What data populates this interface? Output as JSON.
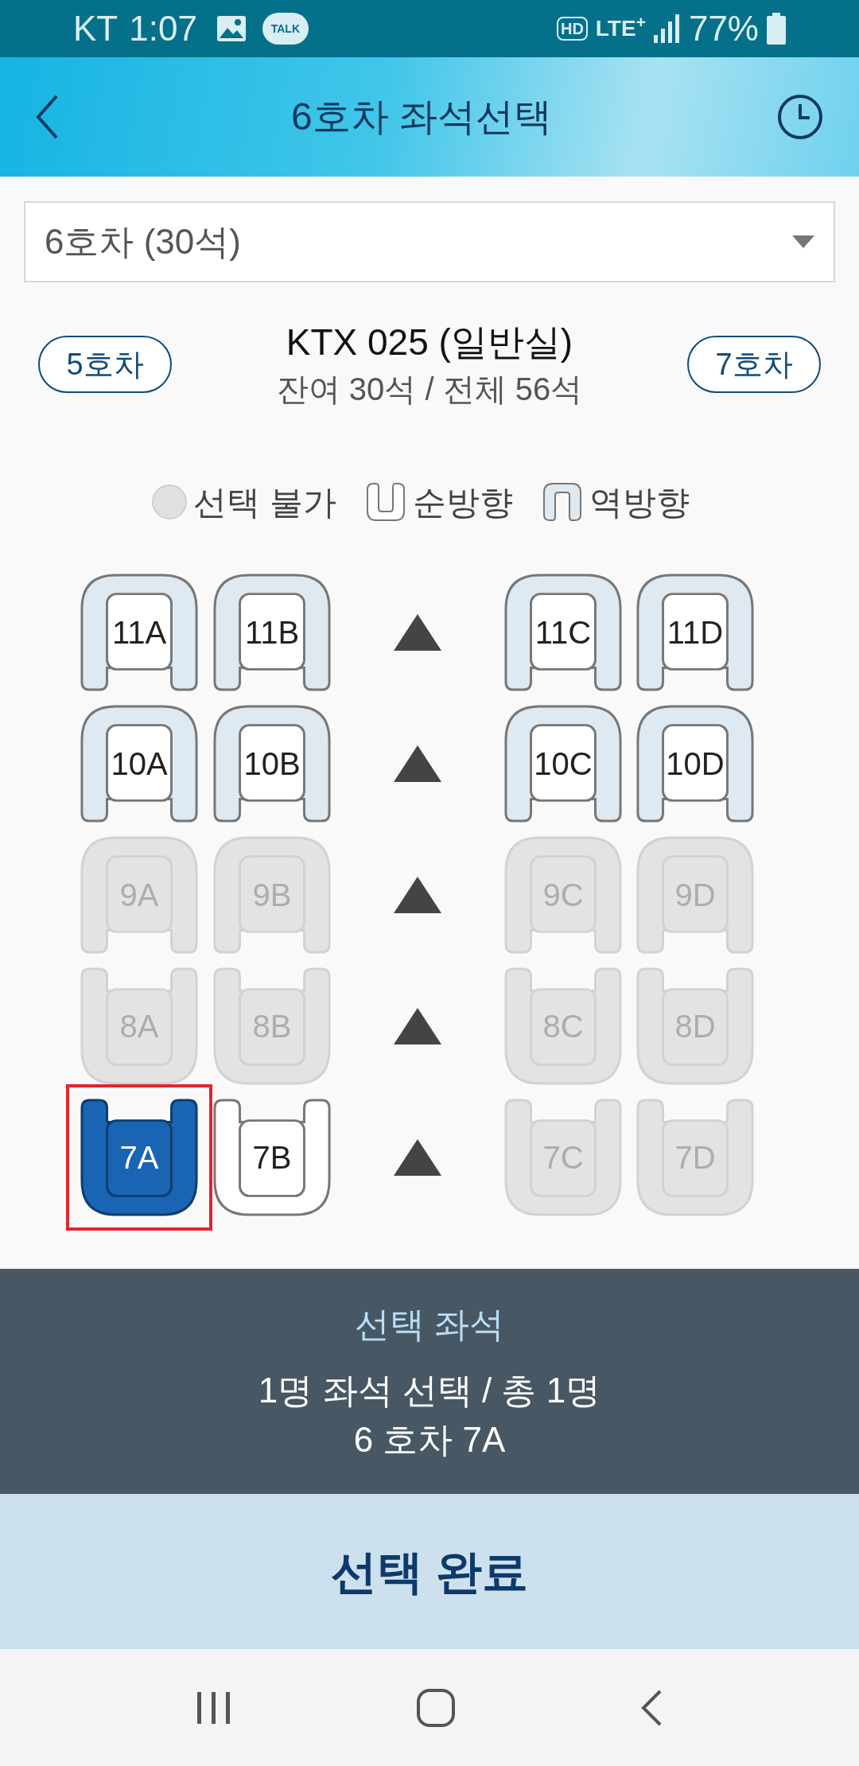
{
  "status_bar": {
    "carrier": "KT",
    "time": "1:07",
    "talk_icon": "TALK",
    "hd_icon": "HD",
    "network": "LTE$^{+}$",
    "battery": "77%"
  },
  "header": {
    "title": "6호차 좌석선택"
  },
  "car_select": {
    "value": "6호차 (30석)"
  },
  "car_nav": {
    "prev": "5호차",
    "next": "7호차",
    "train": "KTX 025 (일반실)",
    "seats_info": "잔여 30석 / 전체 56석"
  },
  "legend": [
    {
      "kind": "unavailable",
      "label": "선택 불가"
    },
    {
      "kind": "forward",
      "label": "순방향"
    },
    {
      "kind": "reverse",
      "label": "역방향"
    }
  ],
  "seat_rows": [
    {
      "seats": [
        {
          "label": "11A",
          "kind": "reverse",
          "available": true,
          "selected": false
        },
        {
          "label": "11B",
          "kind": "reverse",
          "available": true,
          "selected": false
        },
        {
          "label": "11C",
          "kind": "reverse",
          "available": true,
          "selected": false
        },
        {
          "label": "11D",
          "kind": "reverse",
          "available": true,
          "selected": false
        }
      ]
    },
    {
      "seats": [
        {
          "label": "10A",
          "kind": "reverse",
          "available": true,
          "selected": false
        },
        {
          "label": "10B",
          "kind": "reverse",
          "available": true,
          "selected": false
        },
        {
          "label": "10C",
          "kind": "reverse",
          "available": true,
          "selected": false
        },
        {
          "label": "10D",
          "kind": "reverse",
          "available": true,
          "selected": false
        }
      ]
    },
    {
      "seats": [
        {
          "label": "9A",
          "kind": "reverse",
          "available": false,
          "selected": false
        },
        {
          "label": "9B",
          "kind": "reverse",
          "available": false,
          "selected": false
        },
        {
          "label": "9C",
          "kind": "reverse",
          "available": false,
          "selected": false
        },
        {
          "label": "9D",
          "kind": "reverse",
          "available": false,
          "selected": false
        }
      ]
    },
    {
      "seats": [
        {
          "label": "8A",
          "kind": "forward",
          "available": false,
          "selected": false
        },
        {
          "label": "8B",
          "kind": "forward",
          "available": false,
          "selected": false
        },
        {
          "label": "8C",
          "kind": "forward",
          "available": false,
          "selected": false
        },
        {
          "label": "8D",
          "kind": "forward",
          "available": false,
          "selected": false
        }
      ]
    },
    {
      "seats": [
        {
          "label": "7A",
          "kind": "forward",
          "available": true,
          "selected": true
        },
        {
          "label": "7B",
          "kind": "forward",
          "available": true,
          "selected": false
        },
        {
          "label": "7C",
          "kind": "forward",
          "available": false,
          "selected": false
        },
        {
          "label": "7D",
          "kind": "forward",
          "available": false,
          "selected": false
        }
      ]
    }
  ],
  "selection_panel": {
    "title": "선택 좌석",
    "summary": "1명 좌석 선택 / 총 1명",
    "seats": "6 호차 7A"
  },
  "confirm_button": "선택 완료"
}
